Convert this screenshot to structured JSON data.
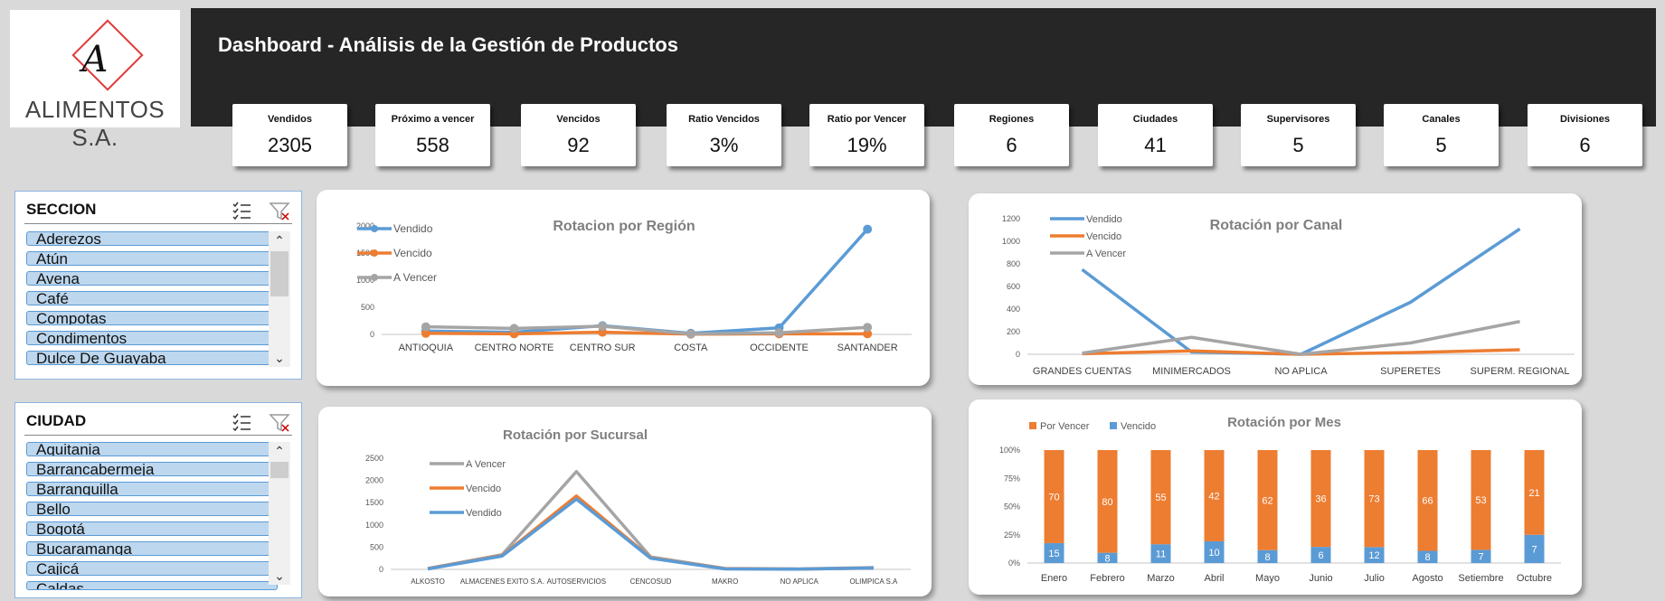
{
  "logo": {
    "letter": "A",
    "name": "ALIMENTOS S.A."
  },
  "header": {
    "title": "Dashboard - Análisis de la Gestión de Productos"
  },
  "kpis": [
    {
      "label": "Vendidos",
      "value": "2305"
    },
    {
      "label": "Próximo a vencer",
      "value": "558"
    },
    {
      "label": "Vencidos",
      "value": "92"
    },
    {
      "label": "Ratio Vencidos",
      "value": "3%"
    },
    {
      "label": "Ratio por Vencer",
      "value": "19%"
    },
    {
      "label": "Regiones",
      "value": "6"
    },
    {
      "label": "Ciudades",
      "value": "41"
    },
    {
      "label": "Supervisores",
      "value": "5"
    },
    {
      "label": "Canales",
      "value": "5"
    },
    {
      "label": "Divisiones",
      "value": "6"
    }
  ],
  "slicers": {
    "seccion": {
      "title": "SECCION",
      "items": [
        "Aderezos",
        "Atún",
        "Avena",
        "Café",
        "Compotas",
        "Condimentos",
        "Dulce De Guayaba"
      ]
    },
    "ciudad": {
      "title": "CIUDAD",
      "items": [
        "Aquitania",
        "Barrancabermeja",
        "Barranquilla",
        "Bello",
        "Bogotá",
        "Bucaramanga",
        "Cajicá",
        "Caldas"
      ]
    }
  },
  "colors": {
    "vendido": "#5b9bd5",
    "vencido": "#ed7d31",
    "a_vencer": "#a5a5a5"
  },
  "chart_data": [
    {
      "id": "region",
      "type": "line",
      "title": "Rotacion por Región",
      "categories": [
        "ANTIOQUIA",
        "CENTRO NORTE",
        "CENTRO SUR",
        "COSTA",
        "OCCIDENTE",
        "SANTANDER"
      ],
      "ylim": [
        0,
        2000
      ],
      "yticks": [
        "0",
        "500",
        "1000",
        "1500",
        "2000"
      ],
      "markers": true,
      "legend": "top-left",
      "series": [
        {
          "name": "Vendido",
          "color": "#5b9bd5",
          "values": [
            60,
            40,
            160,
            20,
            120,
            1940
          ]
        },
        {
          "name": "Vencido",
          "color": "#ed7d31",
          "values": [
            20,
            10,
            40,
            5,
            10,
            10
          ]
        },
        {
          "name": "A Vencer",
          "color": "#a5a5a5",
          "values": [
            140,
            110,
            150,
            10,
            30,
            130
          ]
        }
      ]
    },
    {
      "id": "canal",
      "type": "line",
      "title": "Rotación por Canal",
      "categories": [
        "GRANDES CUENTAS",
        "MINIMERCADOS",
        "NO APLICA",
        "SUPERETES",
        "SUPERM. REGIONAL"
      ],
      "ylim": [
        0,
        1200
      ],
      "yticks": [
        "0",
        "200",
        "400",
        "600",
        "800",
        "1000",
        "1200"
      ],
      "markers": false,
      "legend": "top-left",
      "series": [
        {
          "name": "Vendido",
          "color": "#5b9bd5",
          "values": [
            750,
            20,
            0,
            460,
            1110
          ]
        },
        {
          "name": "Vencido",
          "color": "#ed7d31",
          "values": [
            5,
            30,
            0,
            15,
            40
          ]
        },
        {
          "name": "A Vencer",
          "color": "#a5a5a5",
          "values": [
            10,
            150,
            0,
            100,
            290
          ]
        }
      ]
    },
    {
      "id": "sucursal",
      "type": "line",
      "title": "Rotación por Sucursal",
      "categories": [
        "ALKOSTO",
        "ALMACENES EXITO S.A.",
        "AUTOSERVICIOS",
        "CENCOSUD",
        "MAKRO",
        "NO APLICA",
        "OLIMPICA S.A"
      ],
      "ylim": [
        0,
        2500
      ],
      "yticks": [
        "0",
        "500",
        "1000",
        "1500",
        "2000",
        "2500"
      ],
      "markers": false,
      "legend": "top-left",
      "series": [
        {
          "name": "A Vencer",
          "color": "#a5a5a5",
          "values": [
            20,
            330,
            2200,
            280,
            20,
            10,
            40
          ]
        },
        {
          "name": "Vencido",
          "color": "#ed7d31",
          "values": [
            15,
            310,
            1650,
            260,
            15,
            5,
            30
          ]
        },
        {
          "name": "Vendido",
          "color": "#5b9bd5",
          "values": [
            10,
            300,
            1580,
            250,
            10,
            5,
            30
          ]
        }
      ]
    },
    {
      "id": "mes",
      "type": "bar",
      "stacked": "percent",
      "title": "Rotación por Mes",
      "categories": [
        "Enero",
        "Febrero",
        "Marzo",
        "Abril",
        "Mayo",
        "Junio",
        "Julio",
        "Agosto",
        "Setiembre",
        "Octubre"
      ],
      "yticks": [
        "0%",
        "25%",
        "50%",
        "75%",
        "100%"
      ],
      "legend": "top-left",
      "series": [
        {
          "name": "Vencido",
          "color": "#5b9bd5",
          "values": [
            15,
            8,
            11,
            10,
            8,
            6,
            12,
            8,
            7,
            7
          ]
        },
        {
          "name": "Por Vencer",
          "color": "#ed7d31",
          "values": [
            70,
            80,
            55,
            42,
            62,
            36,
            73,
            66,
            53,
            21
          ]
        }
      ]
    }
  ]
}
